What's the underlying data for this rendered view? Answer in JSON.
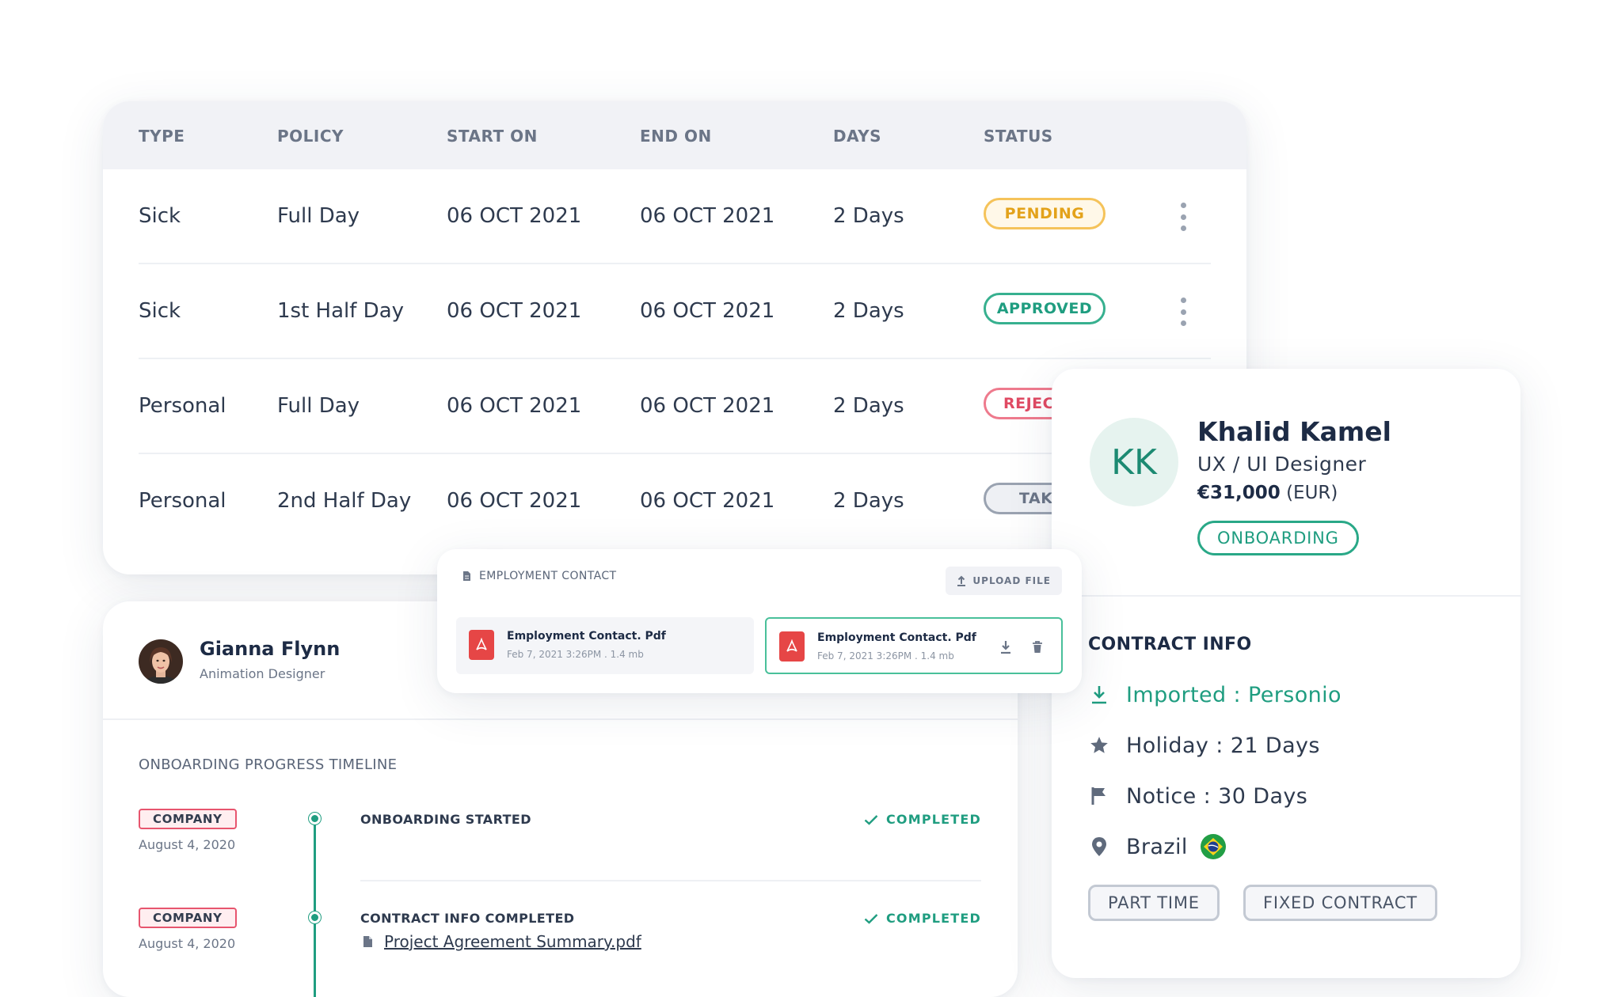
{
  "leave_table": {
    "headers": [
      "TYPE",
      "POLICY",
      "START ON",
      "END ON",
      "DAYS",
      "STATUS"
    ],
    "rows": [
      {
        "type": "Sick",
        "policy": "Full Day",
        "start": "06 OCT 2021",
        "end": "06 OCT 2021",
        "days": "2 Days",
        "status": "PENDING"
      },
      {
        "type": "Sick",
        "policy": "1st Half Day",
        "start": "06 OCT 2021",
        "end": "06 OCT 2021",
        "days": "2 Days",
        "status": "APPROVED"
      },
      {
        "type": "Personal",
        "policy": "Full Day",
        "start": "06 OCT 2021",
        "end": "06 OCT 2021",
        "days": "2 Days",
        "status": "REJEC"
      },
      {
        "type": "Personal",
        "policy": "2nd Half Day",
        "start": "06 OCT 2021",
        "end": "06 OCT 2021",
        "days": "2 Days",
        "status": "TAK"
      }
    ],
    "status_colors": {
      "pending": {
        "text": "#e3a21a",
        "border": "#f5c35a",
        "bg": "#fff8e8"
      },
      "approved": {
        "text": "#1f9d80",
        "border": "#37b08f",
        "bg": "#ffffff"
      },
      "rejected": {
        "text": "#e04a63",
        "border": "#ee7a8d",
        "bg": "#ffffff"
      },
      "taken": {
        "text": "#6b7587",
        "border": "#9aa3b1",
        "bg": "#eef0f4"
      }
    }
  },
  "profile": {
    "initials": "KK",
    "name": "Khalid Kamel",
    "role": "UX / UI Designer",
    "salary_amount": "€31,000",
    "salary_currency": "(EUR)",
    "status": "ONBOARDING",
    "contract_info_title": "CONTRACT INFO",
    "contract_items": [
      {
        "icon": "download-icon",
        "text": "Imported : Personio"
      },
      {
        "icon": "star-icon",
        "text": "Holiday : 21 Days"
      },
      {
        "icon": "flag-icon",
        "text": "Notice : 30 Days"
      },
      {
        "icon": "location-pin-icon",
        "text": "Brazil"
      }
    ],
    "tags": [
      "PART TIME",
      "FIXED CONTRACT"
    ]
  },
  "timeline": {
    "employee_name": "Gianna Flynn",
    "employee_role": "Animation Designer",
    "title": "ONBOARDING PROGRESS TIMELINE",
    "events": [
      {
        "company": "COMPANY",
        "date": "August 4, 2020",
        "event": "ONBOARDING STARTED",
        "status": "COMPLETED"
      },
      {
        "company": "COMPANY",
        "date": "August 4, 2020",
        "event": "CONTRACT INFO COMPLETED",
        "status": "COMPLETED",
        "attachment": "Project Agreement Summary.pdf"
      }
    ]
  },
  "contract_popup": {
    "title": "EMPLOYMENT CONTACT",
    "upload_label": "UPLOAD FILE",
    "files": [
      {
        "name": "Employment Contact. Pdf",
        "meta": "Feb 7, 2021 3:26PM . 1.4 mb"
      },
      {
        "name": "Employment Contact. Pdf",
        "meta": "Feb 7, 2021 3:26PM . 1.4 mb"
      }
    ]
  },
  "colors": {
    "accent_green": "#1f9d80",
    "heading": "#1d2b45",
    "pdf_red": "#e64646"
  }
}
